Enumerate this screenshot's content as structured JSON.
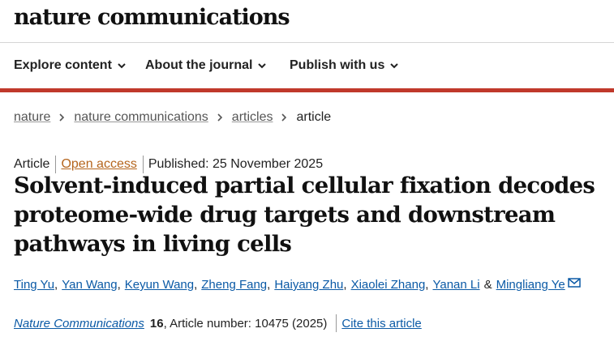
{
  "header": {
    "logo": "nature communications"
  },
  "nav": {
    "items": [
      {
        "label": "Explore content"
      },
      {
        "label": "About the journal"
      },
      {
        "label": "Publish with us"
      }
    ]
  },
  "breadcrumb": {
    "items": [
      "nature",
      "nature communications",
      "articles"
    ],
    "current": "article"
  },
  "article": {
    "type": "Article",
    "access": "Open access",
    "published": "Published: 25 November 2025",
    "title": "Solvent-induced partial cellular fixation decodes proteome-wide drug targets and downstream pathways in living cells",
    "authors": [
      "Ting Yu",
      "Yan Wang",
      "Keyun Wang",
      "Zheng Fang",
      "Haiyang Zhu",
      "Xiaolei Zhang",
      "Yanan Li",
      "Mingliang Ye"
    ],
    "author_separator": ",",
    "author_conjunction": "&",
    "journal": "Nature Communications",
    "volume": "16",
    "article_number": ", Article number: 10475 (2025)",
    "cite_label": "Cite this article"
  },
  "icons": {
    "nav_chevron": "chevron-down-icon",
    "breadcrumb_separator": "chevron-right-icon",
    "corresponding_author": "mail-icon"
  },
  "colors": {
    "accent_bar": "#c0392b",
    "link": "#0b5aa6",
    "open_access": "#b5651d"
  }
}
